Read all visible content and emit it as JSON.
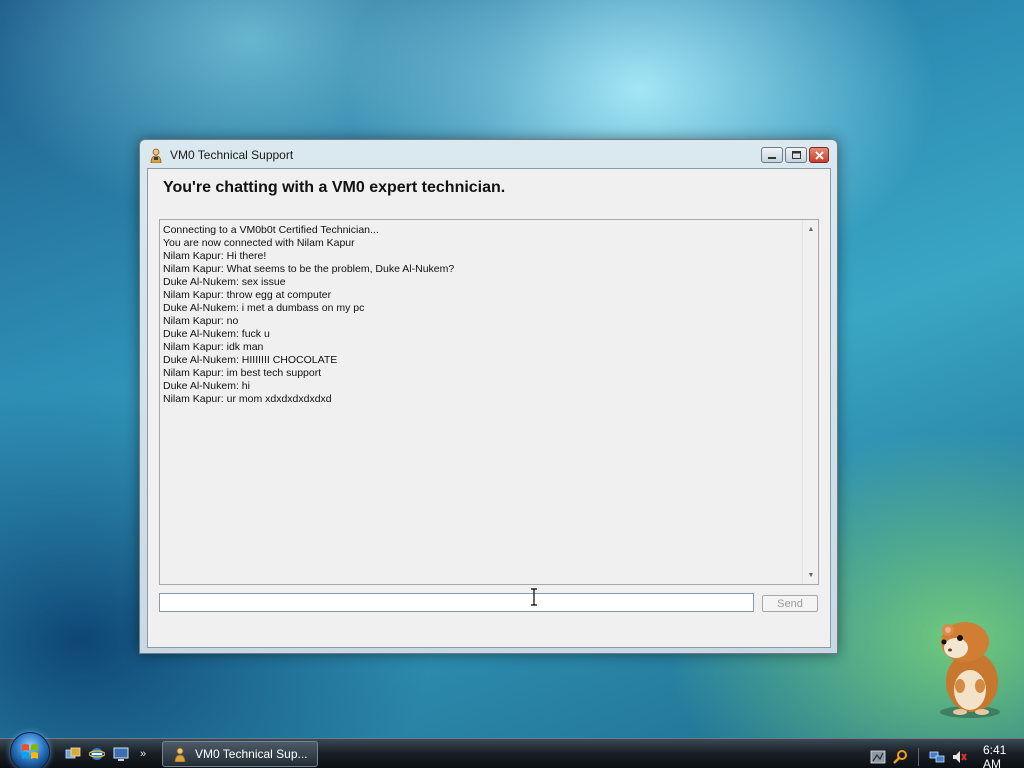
{
  "window": {
    "title": "VM0 Technical Support",
    "heading": "You're chatting with a VM0 expert technician.",
    "chat_lines": [
      "Connecting to a VM0b0t Certified Technician...",
      "You are now connected with Nilam Kapur",
      "Nilam Kapur: Hi there!",
      "Nilam Kapur: What seems to be the problem, Duke Al-Nukem?",
      "Duke Al-Nukem: sex issue",
      "Nilam Kapur: throw egg at computer",
      "Duke Al-Nukem: i met a dumbass on my pc",
      "Nilam Kapur: no",
      "Duke Al-Nukem: fuck u",
      "Nilam Kapur: idk man",
      "Duke Al-Nukem: HIIIIIII CHOCOLATE",
      "Nilam Kapur: im best tech support",
      "Duke Al-Nukem: hi",
      "Nilam Kapur: ur mom xdxdxdxdxdxd"
    ],
    "message_input": {
      "value": "",
      "placeholder": ""
    },
    "send_label": "Send"
  },
  "taskbar": {
    "task_label": "VM0 Technical Sup...",
    "quick_launch_more": "»",
    "clock": "6:41 AM"
  },
  "icons": {
    "app": "technician-icon",
    "start": "windows-start-orb",
    "quick_launch": [
      "switch-windows-icon",
      "internet-explorer-icon",
      "show-desktop-icon"
    ],
    "tray": [
      "tray-app-icon",
      "search-icon",
      "network-icon",
      "volume-muted-icon"
    ]
  },
  "colors": {
    "close_button": "#c5402c",
    "send_disabled_text": "#9a9a9a"
  }
}
